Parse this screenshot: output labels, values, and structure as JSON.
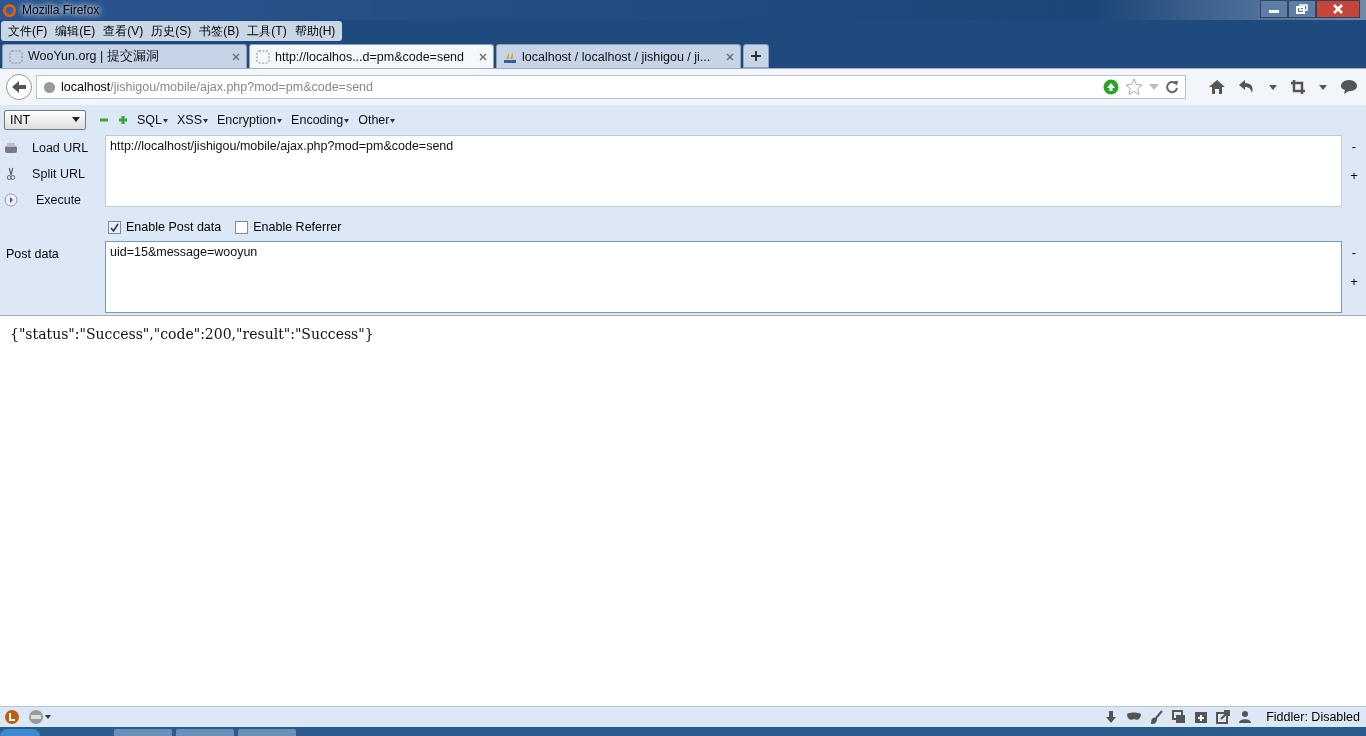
{
  "window": {
    "title": "Mozilla Firefox"
  },
  "menu": [
    "文件(F)",
    "编辑(E)",
    "查看(V)",
    "历史(S)",
    "书签(B)",
    "工具(T)",
    "帮助(H)"
  ],
  "tabs": [
    {
      "label": "WooYun.org | 提交漏洞",
      "selected": false,
      "kind": "page"
    },
    {
      "label": "http://localhos...d=pm&code=send",
      "selected": true,
      "kind": "page"
    },
    {
      "label": "localhost / localhost / jishigou / ji...",
      "selected": false,
      "kind": "pma"
    }
  ],
  "address": {
    "host": "localhost",
    "path": "/jishigou/mobile/ajax.php?mod=pm&code=send"
  },
  "hackbar": {
    "select": "INT",
    "menus": [
      "SQL",
      "XSS",
      "Encryption",
      "Encoding",
      "Other"
    ],
    "actions": [
      "Load URL",
      "Split URL",
      "Execute"
    ],
    "url": "http://localhost/jishigou/mobile/ajax.php?mod=pm&code=send",
    "options": [
      {
        "label": "Enable Post data",
        "checked": true
      },
      {
        "label": "Enable Referrer",
        "checked": false
      }
    ],
    "post_label": "Post data",
    "post": "uid=15&message=wooyun",
    "url_resize": [
      "-",
      "+"
    ],
    "post_resize": [
      "-",
      "+"
    ]
  },
  "response": "{\"status\":\"Success\",\"code\":200,\"result\":\"Success\"}",
  "status_bar": {
    "fiddler": "Fiddler: Disabled"
  }
}
